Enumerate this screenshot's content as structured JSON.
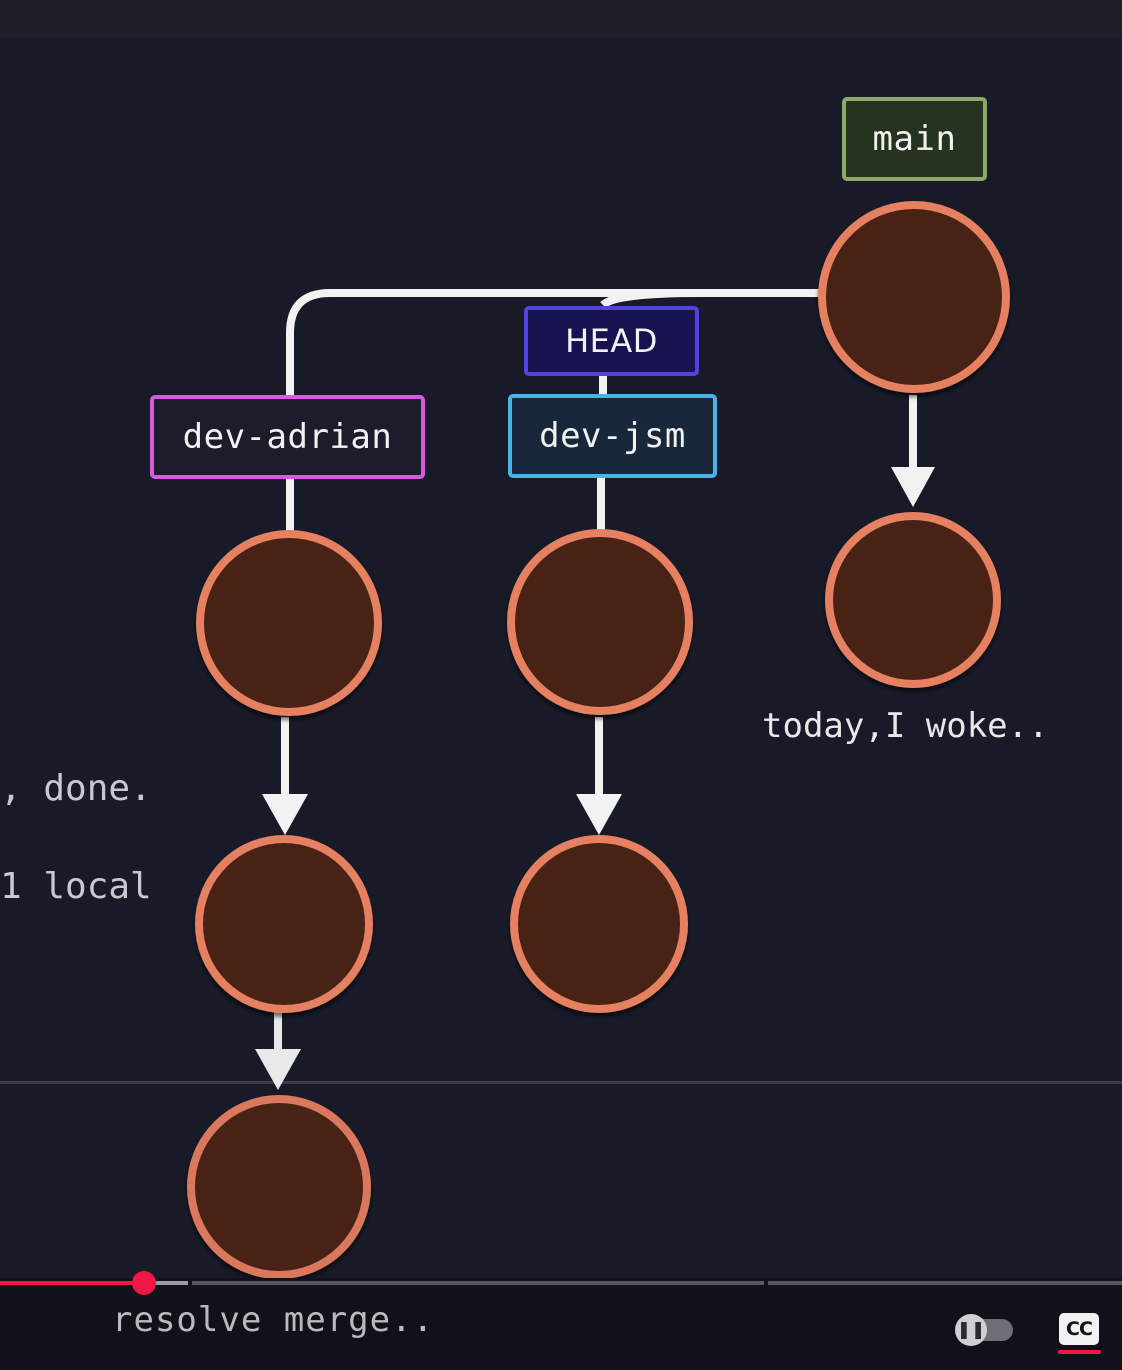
{
  "colors": {
    "background": "#181a28",
    "commit_fill": "#4a2216",
    "commit_stroke": "#e58060",
    "edge": "#f2f2f2",
    "progress": "#f01744"
  },
  "branches": {
    "main": "main",
    "head": "HEAD",
    "dev_adrian": "dev-adrian",
    "dev_jsm": "dev-jsm"
  },
  "commit_messages": {
    "main_second": "today,I woke.."
  },
  "terminal_text": {
    "line1": ", done.",
    "line2": "1 local "
  },
  "player": {
    "caption": "resolve merge..",
    "progress_fraction": 0.128,
    "buffered_fraction": 0.168,
    "autoplay_icon": "pause-icon",
    "captions_icon": "cc-icon",
    "cc_label": "CC"
  }
}
